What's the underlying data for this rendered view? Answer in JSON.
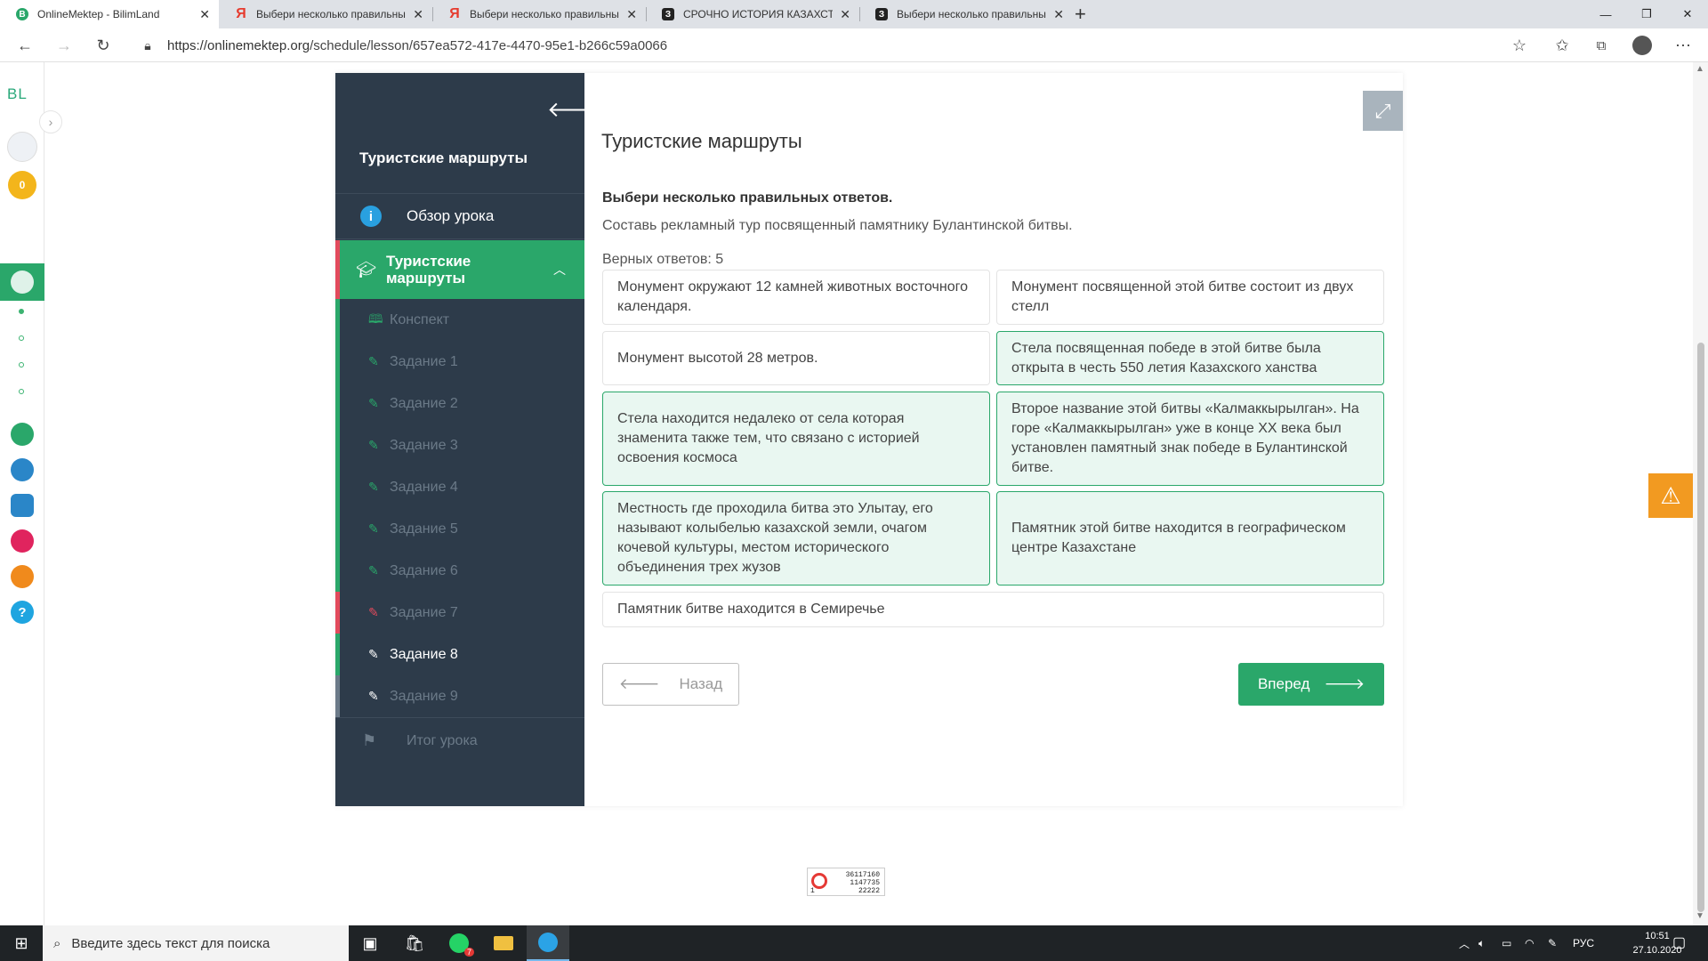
{
  "browser": {
    "tabs": [
      {
        "title": "OnlineMektep - BilimLand",
        "favicon": "bilimland-icon",
        "active": true
      },
      {
        "title": "Выбери несколько правильны",
        "favicon": "yandex-icon",
        "active": false
      },
      {
        "title": "Выбери несколько правильны",
        "favicon": "yandex-icon",
        "active": false
      },
      {
        "title": "СРОЧНО ИСТОРИЯ КАЗАХСТАН",
        "favicon": "znanija-icon",
        "active": false
      },
      {
        "title": "Выбери несколько правильны",
        "favicon": "znanija-icon",
        "active": false
      }
    ],
    "url_host": "https://onlinemektep.org",
    "url_path": "/schedule/lesson/657ea572-417e-4470-95e1-b266c59a0066"
  },
  "rail": {
    "logo": "BL",
    "coins": "0"
  },
  "sidebar": {
    "title": "Туристские маршруты",
    "overview": "Обзор урока",
    "section": "Туристские маршруты",
    "items": [
      {
        "label": "Конспект",
        "icon": "book-icon",
        "state": "normal"
      },
      {
        "label": "Задание 1",
        "icon": "edit-icon",
        "state": "done"
      },
      {
        "label": "Задание 2",
        "icon": "edit-icon",
        "state": "done"
      },
      {
        "label": "Задание 3",
        "icon": "edit-icon",
        "state": "done"
      },
      {
        "label": "Задание 4",
        "icon": "edit-icon",
        "state": "done"
      },
      {
        "label": "Задание 5",
        "icon": "edit-icon",
        "state": "done"
      },
      {
        "label": "Задание 6",
        "icon": "edit-icon",
        "state": "done"
      },
      {
        "label": "Задание 7",
        "icon": "edit-icon",
        "state": "wrong"
      },
      {
        "label": "Задание 8",
        "icon": "edit-icon",
        "state": "current"
      },
      {
        "label": "Задание 9",
        "icon": "edit-icon",
        "state": "pending"
      }
    ],
    "summary": "Итог урока"
  },
  "main": {
    "title": "Туристские маршруты",
    "question_heading": "Выбери несколько правильных ответов.",
    "question_text": "Составь рекламный тур посвященный памятнику Булантинской битвы.",
    "correct_count": "Верных ответов: 5",
    "options": [
      {
        "text": "Монумент окружают 12 камней животных восточного календаря.",
        "selected": false
      },
      {
        "text": "Монумент посвященной этой битве состоит из двух стелл",
        "selected": false
      },
      {
        "text": "Монумент высотой 28 метров.",
        "selected": false
      },
      {
        "text": "Стела посвященная победе в этой битве была открыта в честь 550 летия Казахского ханства",
        "selected": true
      },
      {
        "text": "Стела находится недалеко от села которая знаменита также тем, что связано с историей освоения космоса",
        "selected": true
      },
      {
        "text": "Второе название этой битвы «Калмаккырылган». На горе «Калмаккырылган» уже в конце XX века был установлен памятный знак победе в Булантинской битве.",
        "selected": true
      },
      {
        "text": "Местность где проходила битва это Улытау, его называют колыбелью казахской земли, очагом кочевой культуры, местом исторического объединения трех жузов",
        "selected": true
      },
      {
        "text": "Памятник этой битве находится в географическом центре Казахстане",
        "selected": true
      },
      {
        "text": "Памятник битве находится в Семиречье",
        "selected": false
      }
    ],
    "back_label": "Назад",
    "next_label": "Вперед"
  },
  "counter": {
    "line1": "36117160",
    "line2": "1147735",
    "line3": "22222",
    "line4": "1"
  },
  "taskbar": {
    "search_placeholder": "Введите здесь текст для поиска",
    "whatsapp_badge": "7",
    "lang": "РУС",
    "time": "10:51",
    "date": "27.10.2020"
  },
  "colors": {
    "accent_green": "#2aa76a",
    "sidebar_bg": "#2d3b4a",
    "error_red": "#e24a5c",
    "warning_orange": "#f29a21"
  }
}
